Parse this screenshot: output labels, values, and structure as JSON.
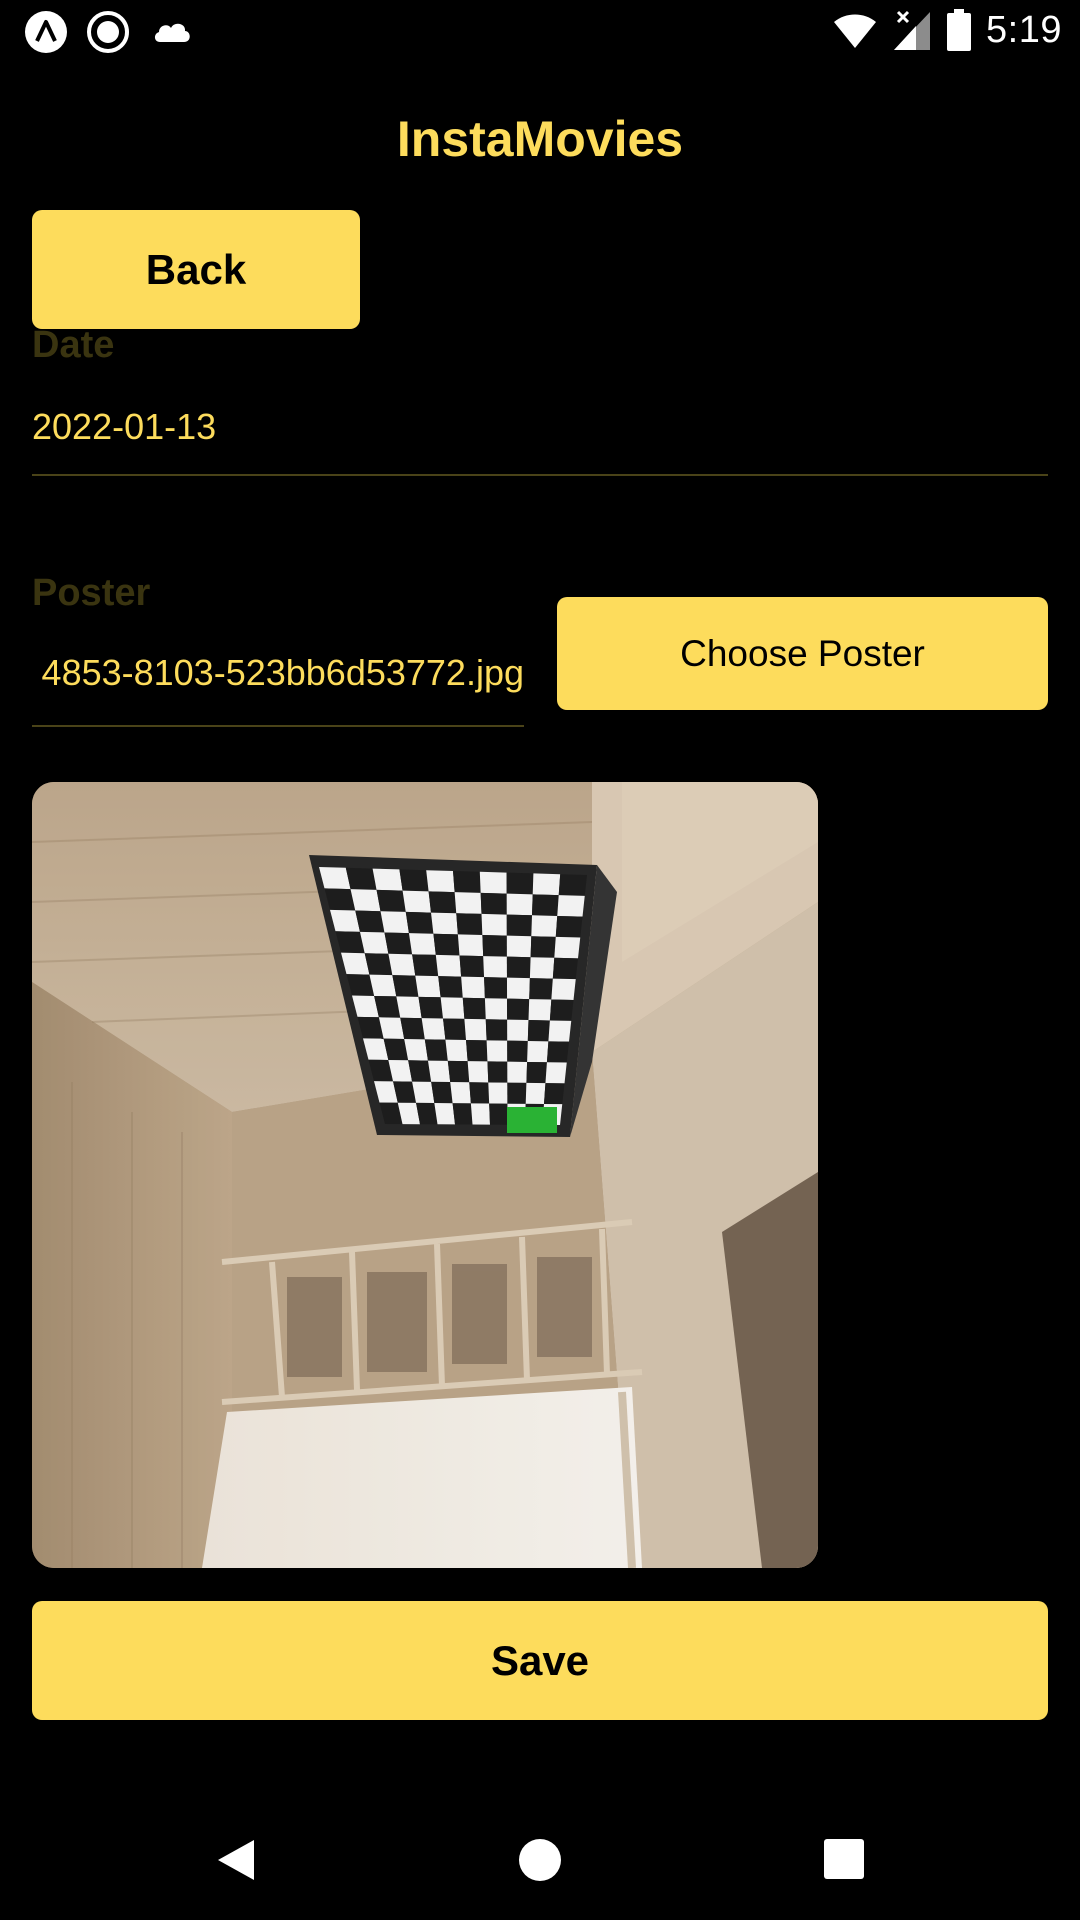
{
  "status_bar": {
    "time": "5:19",
    "left_icons": [
      "app-a-icon",
      "record-icon",
      "cloud-icon"
    ],
    "right_icons": [
      "wifi-icon",
      "signal-no-sim-icon",
      "battery-icon"
    ]
  },
  "app": {
    "title": "InstaMovies"
  },
  "buttons": {
    "back": "Back",
    "choose_poster": "Choose Poster",
    "save": "Save"
  },
  "form": {
    "date": {
      "label": "Date",
      "value": "2022-01-13"
    },
    "poster": {
      "label": "Poster",
      "value": "4853-8103-523bb6d53772.jpg"
    }
  },
  "nav": {
    "icons": [
      "back-triangle-icon",
      "home-circle-icon",
      "recents-square-icon"
    ]
  },
  "colors": {
    "accent": "#FDDC5C",
    "background": "#000000",
    "label_dim": "#3a3410",
    "underline": "#4a4318"
  }
}
